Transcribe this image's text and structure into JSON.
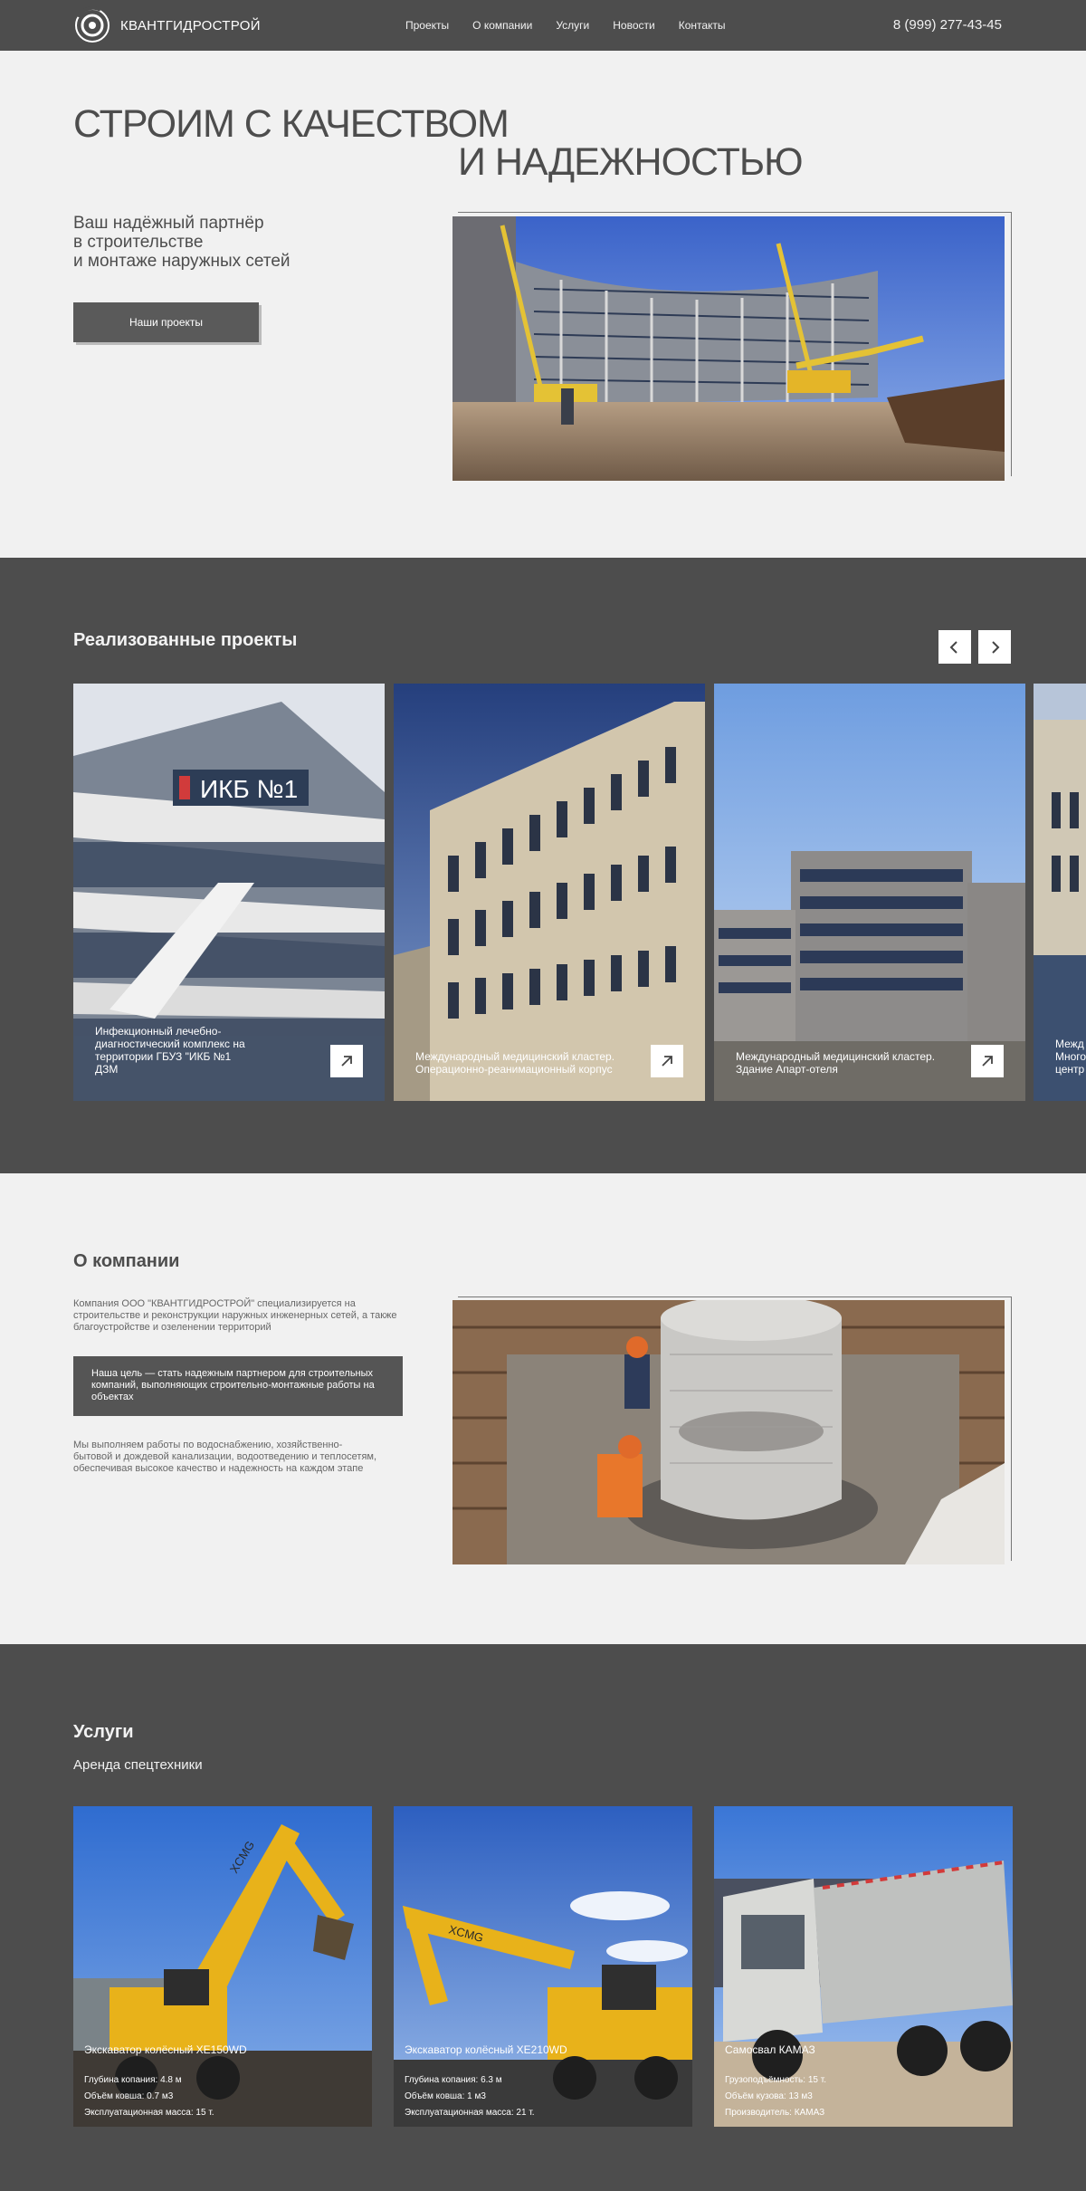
{
  "header": {
    "logo_text": "КВАНТГИДРОСТРОЙ",
    "nav": [
      "Проекты",
      "О компании",
      "Услуги",
      "Новости",
      "Контакты"
    ],
    "phone": "8 (999) 277-43-45"
  },
  "hero": {
    "title_line1": "СТРОИМ С КАЧЕСТВОМ",
    "title_line2": "И НАДЕЖНОСТЬЮ",
    "subtitle_line1": "Ваш надёжный партнёр",
    "subtitle_line2": "в строительстве",
    "subtitle_line3": "и монтаже наружных сетей",
    "button": "Наши проекты"
  },
  "projects": {
    "title": "Реализованные проекты",
    "cards": [
      {
        "caption": "Инфекционный лечебно-диагностический комплекс на территории ГБУЗ \"ИКБ №1 ДЗМ"
      },
      {
        "caption": "Международный медицинский кластер. Операционно-реанимационный корпус"
      },
      {
        "caption": "Международный медицинский кластер. Здание Апарт-отеля"
      },
      {
        "caption": "Межд Много центр"
      }
    ],
    "sign_text": "ИКБ №1"
  },
  "about": {
    "title": "О компании",
    "p1": "Компания ООО \"КВАНТГИДРОСТРОЙ\" специализируется на строительстве и реконструкции наружных инженерных сетей, а также благоустройстве и озеленении территорий",
    "goal": "Наша цель — стать надежным партнером для строительных компаний, выполняющих строительно-монтажные работы на объектах",
    "p2": "Мы выполняем работы по водоснабжению, хозяйственно-бытовой и дождевой канализации, водоотведению и теплосетям, обеспечивая высокое качество и надежность на каждом этапе"
  },
  "services": {
    "title": "Услуги",
    "subtitle": "Аренда спецтехники",
    "items": [
      {
        "name": "Экскаватор колёсный XE150WD",
        "spec1": "Глубина копания: 4.8 м",
        "spec2": "Объём ковша: 0.7 м3",
        "spec3": "Эксплуатационная масса: 15 т."
      },
      {
        "name": "Экскаватор колёсный XE210WD",
        "spec1": "Глубина копания: 6.3 м",
        "spec2": "Объём ковша: 1 м3",
        "spec3": "Эксплуатационная масса: 21 т."
      },
      {
        "name": "Самосвал КАМАЗ",
        "spec1": "Грузоподъёмность: 15 т.",
        "spec2": "Объём кузова: 13 м3",
        "spec3": "Производитель: КАМАЗ"
      }
    ],
    "brand": "XCMG"
  },
  "colors": {
    "dark": "#4d4d4d",
    "light": "#f1f1f1",
    "button": "#5a5a5a"
  },
  "icons": [
    "logo-icon",
    "chevron-left-icon",
    "chevron-right-icon",
    "arrow-up-right-icon"
  ]
}
